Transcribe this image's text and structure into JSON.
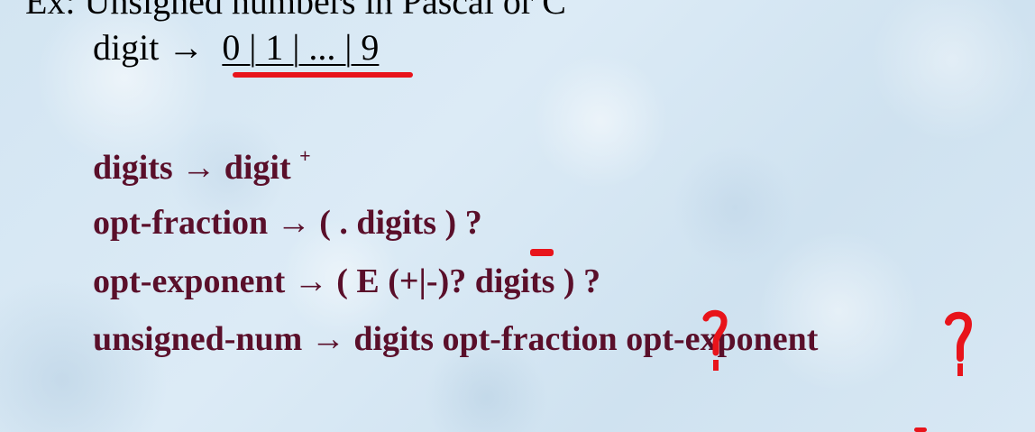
{
  "title": "Ex: Unsigned numbers in Pascal or C",
  "digit_rule": {
    "lhs": "digit",
    "arrow": "→",
    "rhs": "0 | 1 | ... | 9"
  },
  "rules": [
    {
      "lhs": "digits",
      "arrow": "→",
      "rhs": "digit",
      "sup": "+"
    },
    {
      "lhs": "opt-fraction",
      "arrow": "→",
      "rhs": "( . digits ) ?"
    },
    {
      "lhs": "opt-exponent",
      "arrow": "→",
      "rhs": "( E (+|-)? digits ) ?"
    },
    {
      "lhs": "unsigned-num",
      "arrow": "→",
      "rhs": "digits opt-fraction opt-exponent"
    }
  ],
  "colors": {
    "rule_text": "#5a0f2a",
    "annotation": "#e8141b",
    "plain_text": "#000000"
  }
}
